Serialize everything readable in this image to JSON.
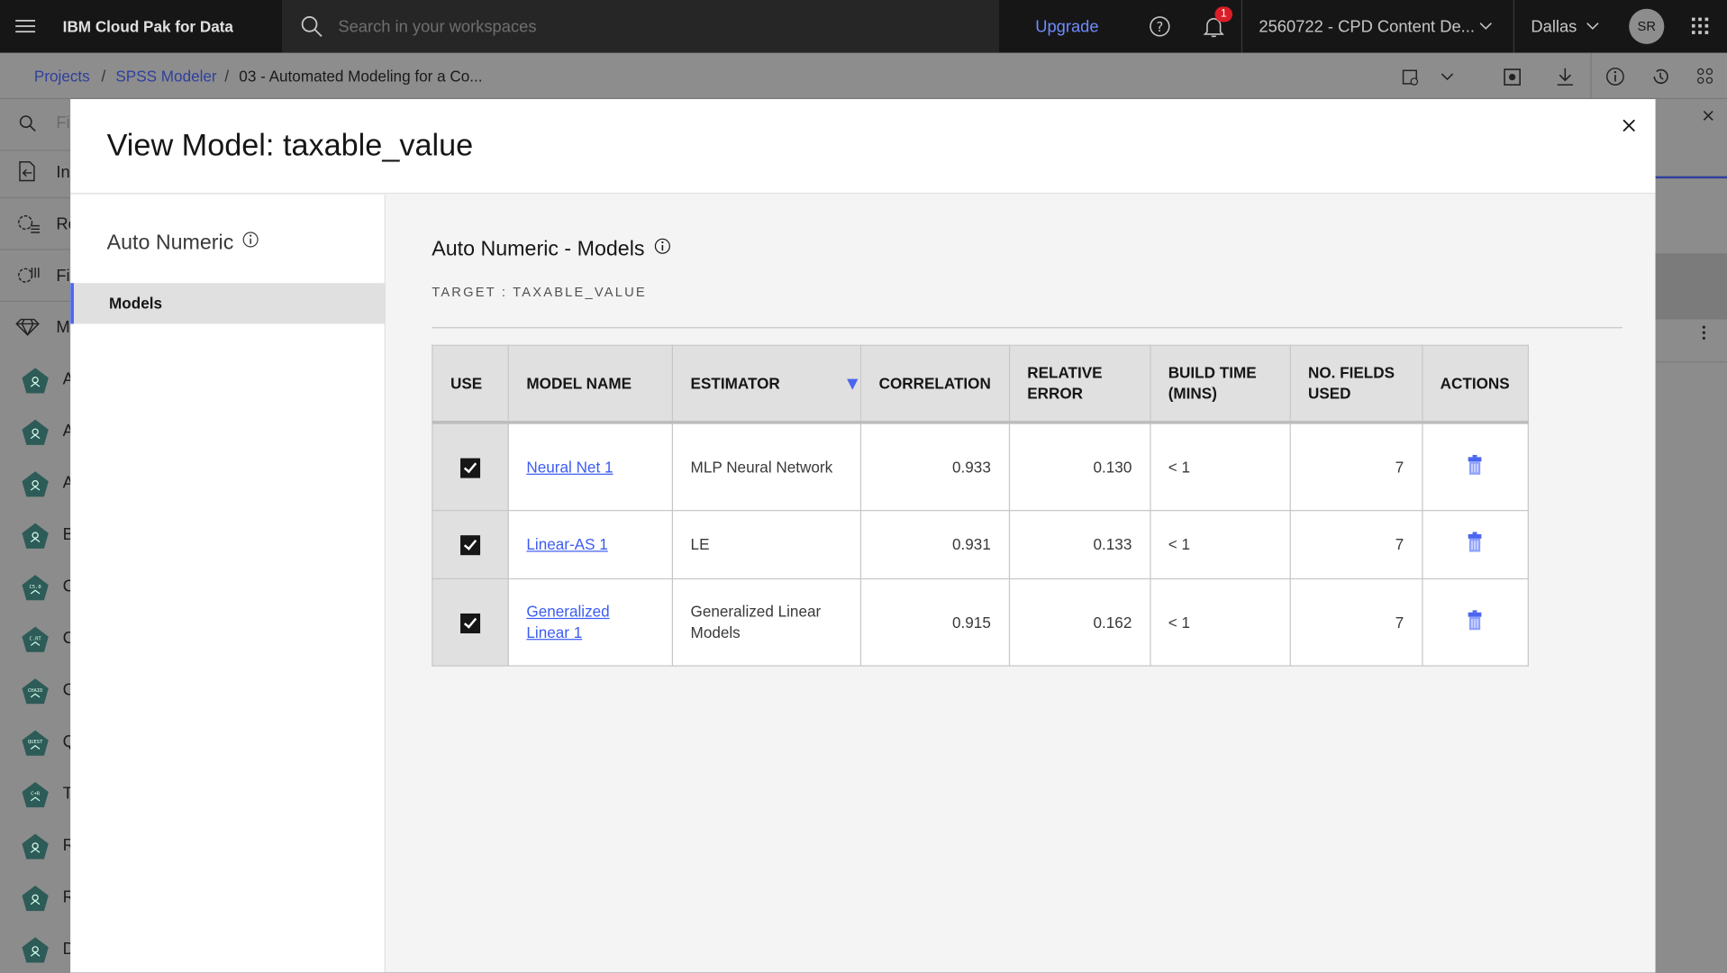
{
  "topbar": {
    "product": "IBM Cloud Pak for Data",
    "search_placeholder": "Search in your workspaces",
    "upgrade": "Upgrade",
    "notification_count": "1",
    "account": "2560722 - CPD Content De...",
    "region": "Dallas",
    "avatar": "SR"
  },
  "breadcrumb": {
    "items": [
      "Projects",
      "SPSS Modeler",
      "03 - Automated Modeling for a Co..."
    ],
    "separator": "/"
  },
  "sidebar": {
    "search_placeholder": "Fi",
    "items": [
      {
        "label": "In",
        "icon": "import-icon"
      },
      {
        "label": "Re",
        "icon": "record-ops-icon"
      },
      {
        "label": "Fi",
        "icon": "field-ops-icon"
      },
      {
        "label": "M",
        "icon": "diamond-icon"
      }
    ],
    "nodes": [
      {
        "label": "A",
        "glyph": ""
      },
      {
        "label": "A",
        "glyph": ""
      },
      {
        "label": "A",
        "glyph": ""
      },
      {
        "label": "B",
        "glyph": ""
      },
      {
        "label": "C",
        "glyph": "C5.0"
      },
      {
        "label": "C",
        "glyph": "C.RT"
      },
      {
        "label": "C",
        "glyph": "CHAID"
      },
      {
        "label": "Q",
        "glyph": "QUEST"
      },
      {
        "label": "T",
        "glyph": "C+R"
      },
      {
        "label": "R",
        "glyph": ""
      },
      {
        "label": "R",
        "glyph": ""
      },
      {
        "label": "D",
        "glyph": ""
      }
    ]
  },
  "modal": {
    "title": "View Model: taxable_value",
    "left_title": "Auto Numeric",
    "nav": [
      {
        "label": "Models",
        "selected": true
      }
    ],
    "section_title": "Auto Numeric - Models",
    "target": "TARGET : TAXABLE_VALUE",
    "table": {
      "headers": [
        "USE",
        "MODEL NAME",
        "ESTIMATOR",
        "CORRELATION",
        "RELATIVE ERROR",
        "BUILD TIME (MINS)",
        "NO. FIELDS USED",
        "ACTIONS"
      ],
      "rows": [
        {
          "use": true,
          "name": "Neural Net 1",
          "estimator": "MLP Neural Network",
          "correlation": "0.933",
          "relative_error": "0.130",
          "build_time": "< 1",
          "fields": "7"
        },
        {
          "use": true,
          "name": "Linear-AS 1",
          "estimator": "LE",
          "correlation": "0.931",
          "relative_error": "0.133",
          "build_time": "< 1",
          "fields": "7"
        },
        {
          "use": true,
          "name": "Generalized Linear 1",
          "estimator": "Generalized Linear Models",
          "correlation": "0.915",
          "relative_error": "0.162",
          "build_time": "< 1",
          "fields": "7"
        }
      ]
    }
  },
  "colors": {
    "accent": "#4b65f0",
    "link": "#3c5cf0",
    "topbar": "#161616",
    "node": "#2d5b57",
    "badge": "#da1e28"
  }
}
